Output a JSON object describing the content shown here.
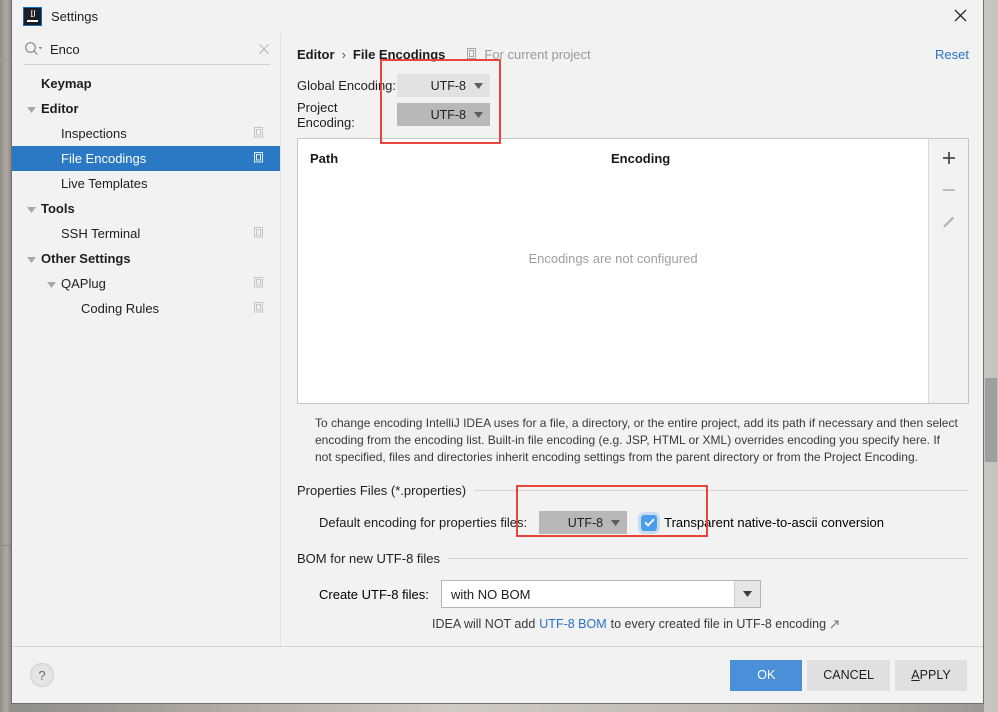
{
  "window": {
    "title": "Settings",
    "logo_icon": "intellij-idea-logo",
    "close_icon": "close-icon"
  },
  "search": {
    "icon": "search-icon",
    "value": "Enco",
    "clear_icon": "close-icon"
  },
  "sidebar": {
    "items": [
      {
        "label": "Keymap",
        "indent": 0,
        "bold": true,
        "twisty": "none",
        "copy_icon": false,
        "selected": false
      },
      {
        "label": "Editor",
        "indent": 0,
        "bold": true,
        "twisty": "expanded",
        "copy_icon": false,
        "selected": false
      },
      {
        "label": "Inspections",
        "indent": 1,
        "bold": false,
        "twisty": "none",
        "copy_icon": true,
        "selected": false
      },
      {
        "label": "File Encodings",
        "indent": 1,
        "bold": false,
        "twisty": "none",
        "copy_icon": true,
        "selected": true
      },
      {
        "label": "Live Templates",
        "indent": 1,
        "bold": false,
        "twisty": "none",
        "copy_icon": false,
        "selected": false
      },
      {
        "label": "Tools",
        "indent": 0,
        "bold": true,
        "twisty": "expanded",
        "copy_icon": false,
        "selected": false
      },
      {
        "label": "SSH Terminal",
        "indent": 1,
        "bold": false,
        "twisty": "none",
        "copy_icon": true,
        "selected": false
      },
      {
        "label": "Other Settings",
        "indent": 0,
        "bold": true,
        "twisty": "expanded",
        "copy_icon": false,
        "selected": false
      },
      {
        "label": "QAPlug",
        "indent": 1,
        "bold": false,
        "twisty": "expanded",
        "copy_icon": true,
        "selected": false
      },
      {
        "label": "Coding Rules",
        "indent": 2,
        "bold": false,
        "twisty": "none",
        "copy_icon": true,
        "selected": false
      }
    ]
  },
  "breadcrumb": {
    "parent": "Editor",
    "separator": "›",
    "current": "File Encodings",
    "scope_icon": "module-icon",
    "scope_note": "For current project",
    "reset_label": "Reset"
  },
  "encodings": {
    "global_label": "Global Encoding:",
    "global_value": "UTF-8",
    "project_label": "Project Encoding:",
    "project_value": "UTF-8",
    "caret_icon": "chevron-down-icon"
  },
  "table": {
    "col_path": "Path",
    "col_encoding": "Encoding",
    "empty_message": "Encodings are not configured",
    "tools": [
      {
        "icon": "plus-icon",
        "name": "add-encoding-button"
      },
      {
        "icon": "minus-icon",
        "name": "remove-encoding-button"
      },
      {
        "icon": "pencil-icon",
        "name": "edit-encoding-button"
      }
    ]
  },
  "description": "To change encoding IntelliJ IDEA uses for a file, a directory, or the entire project, add its path if necessary and then select encoding from the encoding list. Built-in file encoding (e.g. JSP, HTML or XML) overrides encoding you specify here. If not specified, files and directories inherit encoding settings from the parent directory or from the Project Encoding.",
  "properties_section": {
    "title": "Properties Files (*.properties)",
    "default_encoding_label": "Default encoding for properties files:",
    "default_encoding_value": "UTF-8",
    "checkbox_label": "Transparent native-to-ascii conversion",
    "checkbox_checked": true,
    "check_icon": "check-icon"
  },
  "bom_section": {
    "title": "BOM for new UTF-8 files",
    "create_label": "Create UTF-8 files:",
    "create_value": "with NO BOM",
    "hint_prefix": "IDEA will NOT add",
    "hint_link": "UTF-8 BOM",
    "hint_suffix": "to every created file in UTF-8 encoding",
    "external_link_icon": "external-link-icon"
  },
  "footer": {
    "help_label": "?",
    "ok_label": "OK",
    "cancel_label": "CANCEL",
    "apply_label": "APPL",
    "apply_mnemonic": "A",
    "apply_rest": "PPLY"
  },
  "colors": {
    "accent_blue": "#2b79c4",
    "link_blue": "#2573c4",
    "primary_button": "#4a90d9",
    "checkbox_blue": "#4a9eea",
    "annotation_red": "#e8453c"
  }
}
